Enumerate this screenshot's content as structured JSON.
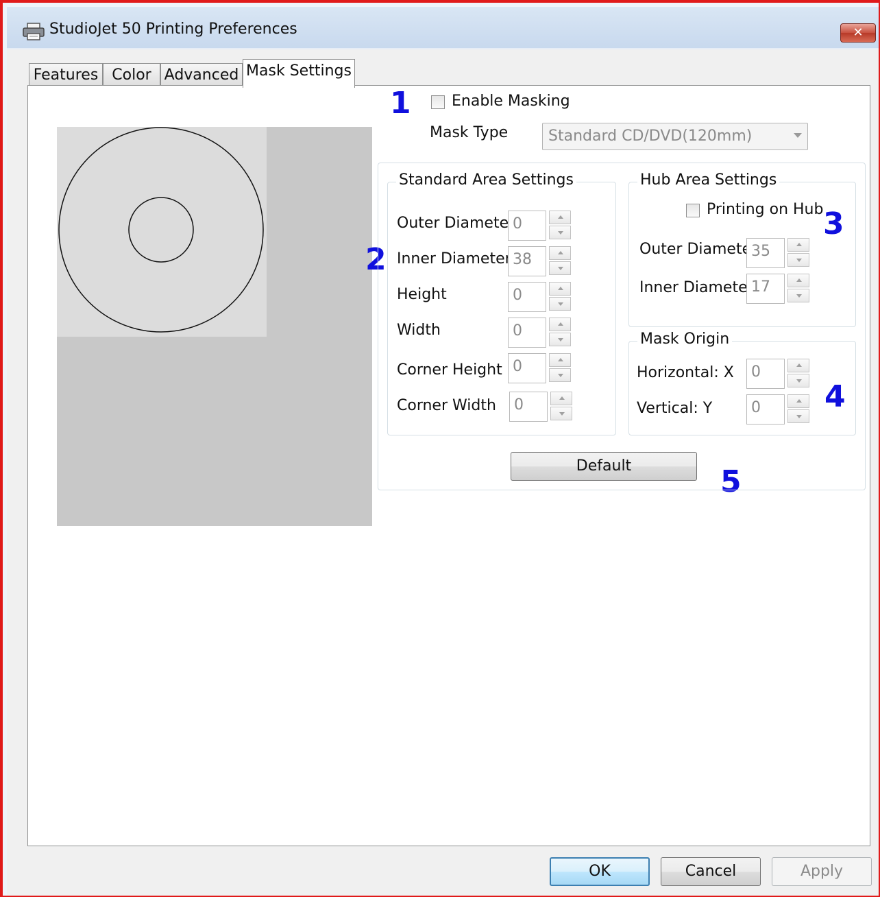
{
  "window": {
    "title": "StudioJet 50 Printing Preferences",
    "close_label": "✕"
  },
  "tabs": [
    {
      "label": "Features"
    },
    {
      "label": "Color"
    },
    {
      "label": "Advanced"
    },
    {
      "label": "Mask Settings",
      "active": true
    }
  ],
  "markers": [
    "1",
    "2",
    "3",
    "4",
    "5"
  ],
  "masking": {
    "enable_label": "Enable Masking",
    "enabled": false,
    "mask_type_label": "Mask Type",
    "mask_type_value": "Standard CD/DVD(120mm)"
  },
  "standard_area": {
    "title": "Standard Area Settings",
    "fields": [
      {
        "label": "Outer Diameter",
        "value": "0"
      },
      {
        "label": "Inner Diameter",
        "value": "38"
      },
      {
        "label": "Height",
        "value": "0"
      },
      {
        "label": "Width",
        "value": "0"
      },
      {
        "label": "Corner Height",
        "value": "0"
      },
      {
        "label": "Corner Width",
        "value": "0"
      }
    ]
  },
  "hub_area": {
    "title": "Hub Area Settings",
    "printing_on_hub_label": "Printing on Hub",
    "printing_on_hub": false,
    "fields": [
      {
        "label": "Outer Diameter",
        "value": "35"
      },
      {
        "label": "Inner Diameter",
        "value": "17"
      }
    ]
  },
  "mask_origin": {
    "title": "Mask Origin",
    "fields": [
      {
        "label": "Horizontal: X",
        "value": "0"
      },
      {
        "label": "Vertical: Y",
        "value": "0"
      }
    ]
  },
  "buttons": {
    "default": "Default",
    "ok": "OK",
    "cancel": "Cancel",
    "apply": "Apply"
  },
  "colors": {
    "marker": "#1010dd",
    "frame": "#e01a1a"
  }
}
